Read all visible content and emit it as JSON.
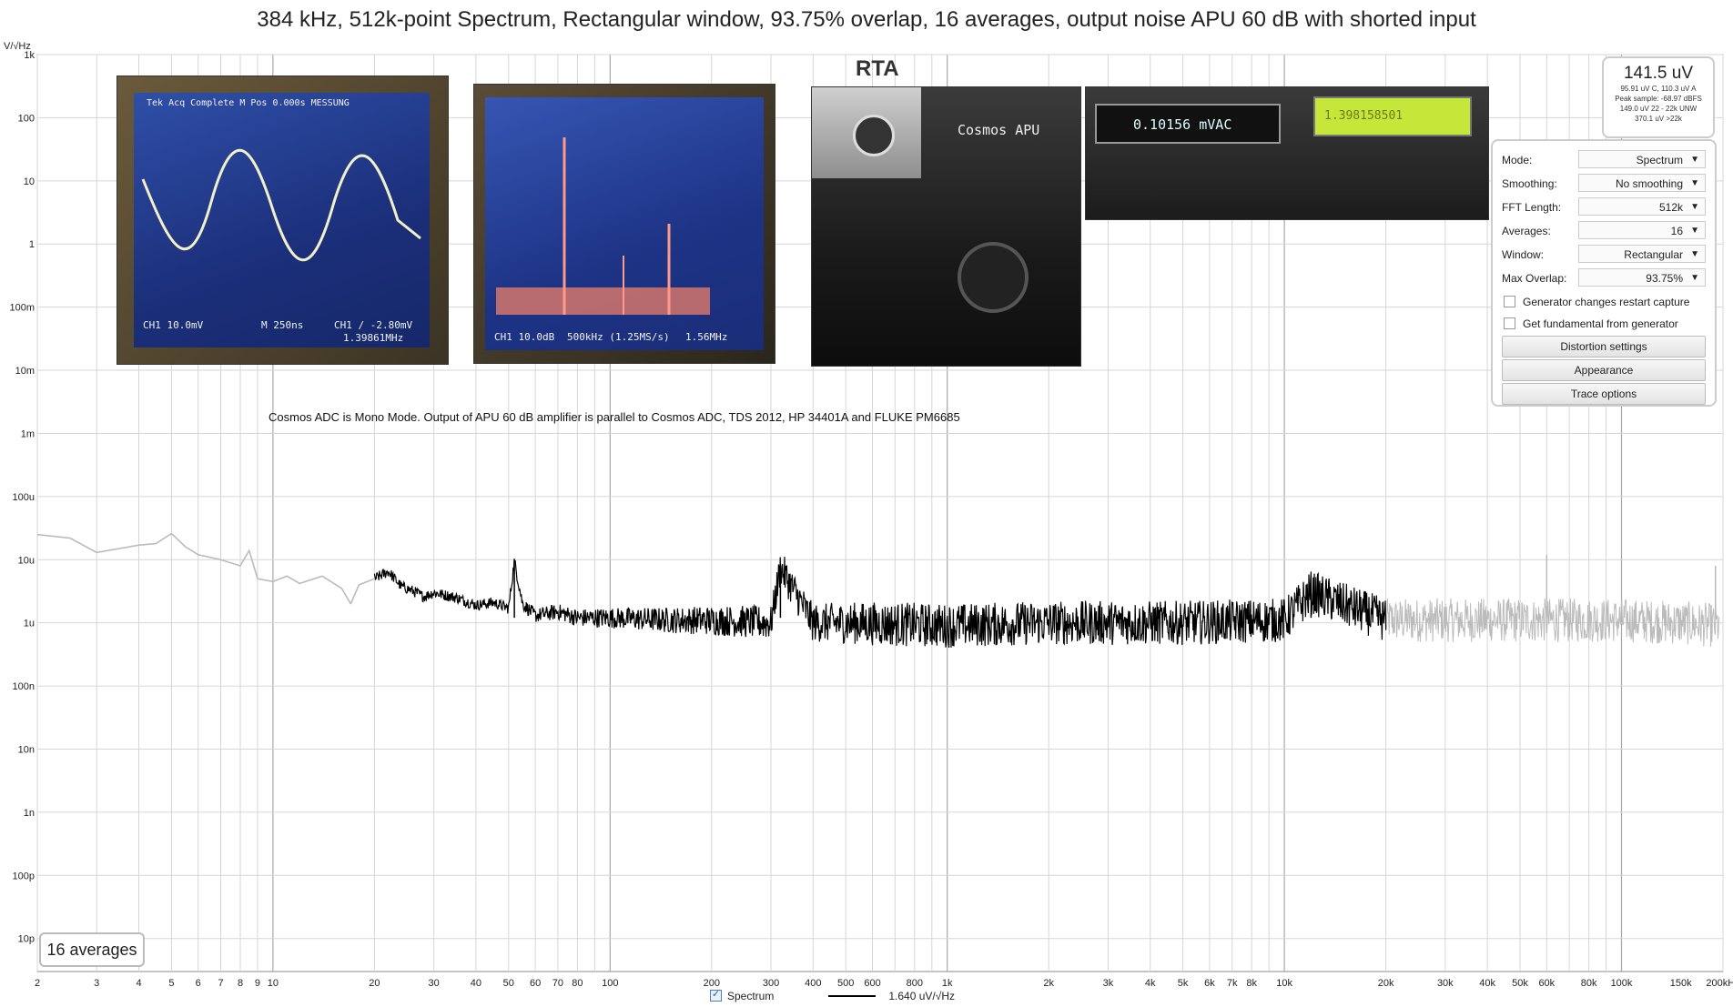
{
  "title": "384 kHz, 512k-point Spectrum, Rectangular window, 93.75% overlap, 16 averages, output noise APU 60 dB with shorted input",
  "rta_label": "RTA",
  "annotation": "Cosmos ADC is Mono Mode. Output of APU  60 dB amplifier is parallel to Cosmos ADC, TDS 2012, HP 34401A and FLUKE PM6685",
  "averages_badge": "16 averages",
  "readout": {
    "main": "141.5 uV",
    "line1": "95.91 uV C, 110.3 uV A",
    "line2": "Peak sample: -68.97 dBFS",
    "line3": "149.0 uV 22 - 22k UNW",
    "line4": "370.1 uV >22k"
  },
  "panel": {
    "mode_label": "Mode:",
    "mode_value": "Spectrum",
    "smoothing_label": "Smoothing:",
    "smoothing_value": "No smoothing",
    "fft_label": "FFT Length:",
    "fft_value": "512k",
    "averages_label": "Averages:",
    "averages_value": "16",
    "window_label": "Window:",
    "window_value": "Rectangular",
    "overlap_label": "Max Overlap:",
    "overlap_value": "93.75%",
    "gen_restart": "Generator changes restart capture",
    "fundamental": "Get fundamental from generator",
    "distortion_btn": "Distortion settings",
    "appearance_btn": "Appearance",
    "trace_btn": "Trace options"
  },
  "legend": {
    "spectrum_label": "Spectrum",
    "value": "1.640 uV/√Hz"
  },
  "photos": {
    "osc1": {
      "top": "Tek   Acq Complete   M Pos 0.000s   MESSUNG",
      "ch": "CH1 10.0mV",
      "time": "M 250ns",
      "meas": "CH1 ∕ -2.80mV",
      "freq": "1.39861MHz"
    },
    "osc2": {
      "ch": "CH1 10.0dB",
      "span": "500kHz (1.25MS/s)",
      "freq": "1.56MHz"
    },
    "apu": {
      "brand": "Cosmos APU"
    },
    "meter": {
      "value": "0.10156 mVAC",
      "fluke": "1.398158501"
    }
  },
  "colors": {
    "trace": "#000000",
    "trace_outside": "#bbbbbb",
    "grid": "#d6d6d6",
    "grid_major": "#a8a8a8"
  },
  "chart_data": {
    "type": "line",
    "title": "384 kHz, 512k-point Spectrum, Rectangular window, 93.75% overlap, 16 averages, output noise APU 60 dB with shorted input",
    "xlabel": "",
    "ylabel": "V/√Hz",
    "x_scale": "log",
    "y_scale": "log",
    "xlim": [
      2,
      200000
    ],
    "ylim": [
      3e-12,
      1000
    ],
    "grid": true,
    "x_ticks": [
      "2",
      "3",
      "4",
      "5",
      "6",
      "7",
      "8",
      "9",
      "10",
      "20",
      "30",
      "40",
      "50",
      "60",
      "70",
      "80",
      "100",
      "200",
      "300",
      "400",
      "500",
      "600",
      "800",
      "1k",
      "2k",
      "3k",
      "4k",
      "5k",
      "6k",
      "7k",
      "8k",
      "10k",
      "20k",
      "30k",
      "40k",
      "50k",
      "60k",
      "80k",
      "100k",
      "150k",
      "200kHz"
    ],
    "x_tick_values": [
      2,
      3,
      4,
      5,
      6,
      7,
      8,
      9,
      10,
      20,
      30,
      40,
      50,
      60,
      70,
      80,
      100,
      200,
      300,
      400,
      500,
      600,
      800,
      1000,
      2000,
      3000,
      4000,
      5000,
      6000,
      7000,
      8000,
      10000,
      20000,
      30000,
      40000,
      50000,
      60000,
      80000,
      100000,
      150000,
      200000
    ],
    "y_ticks": [
      "1k",
      "100",
      "10",
      "1",
      "100m",
      "10m",
      "1m",
      "100u",
      "10u",
      "1u",
      "100n",
      "10n",
      "1n",
      "100p",
      "10p"
    ],
    "y_tick_values": [
      1000,
      100,
      10,
      1,
      0.1,
      0.01,
      0.001,
      0.0001,
      1e-05,
      1e-06,
      1e-07,
      1e-08,
      1e-09,
      1e-10,
      1e-11
    ],
    "series": [
      {
        "name": "Spectrum",
        "display_range": [
          20,
          20000
        ],
        "x": [
          2,
          2.5,
          3,
          3.5,
          4,
          4.5,
          5,
          5.5,
          6,
          7,
          8,
          8.5,
          9,
          10,
          11,
          12,
          14,
          16,
          17,
          18,
          20,
          22,
          24,
          26,
          28,
          30,
          35,
          40,
          45,
          50,
          52,
          55,
          60,
          70,
          80,
          100,
          150,
          200,
          300,
          320,
          400,
          500,
          1000,
          2000,
          3000,
          5000,
          10000,
          12000,
          20000,
          50000,
          100000,
          150000,
          195000
        ],
        "y": [
          2.5e-05,
          2.2e-05,
          1.3e-05,
          1.5e-05,
          1.7e-05,
          1.8e-05,
          2.6e-05,
          1.6e-05,
          1.2e-05,
          1e-05,
          8e-06,
          1.4e-05,
          5e-06,
          4.5e-06,
          5.5e-06,
          4.2e-06,
          5.5e-06,
          3.5e-06,
          2e-06,
          4e-06,
          5e-06,
          6.5e-06,
          3.8e-06,
          3.2e-06,
          2.6e-06,
          3e-06,
          2.5e-06,
          1.9e-06,
          2.1e-06,
          1.7e-06,
          9.5e-06,
          2e-06,
          1.3e-06,
          1.5e-06,
          1.2e-06,
          1.2e-06,
          1.1e-06,
          1.1e-06,
          1e-06,
          7.5e-06,
          1e-06,
          1e-06,
          9e-07,
          1e-06,
          1e-06,
          1e-06,
          1.1e-06,
          3e-06,
          1.1e-06,
          1.1e-06,
          1.1e-06,
          1e-06,
          9e-07
        ],
        "noise_band_decades": 0.35,
        "spurs": [
          [
            52,
            9.5e-06
          ],
          [
            320,
            7.5e-06
          ],
          [
            12000,
            3e-06
          ],
          [
            60000,
            1.2e-05
          ],
          [
            190000,
            8e-06
          ]
        ]
      }
    ]
  }
}
